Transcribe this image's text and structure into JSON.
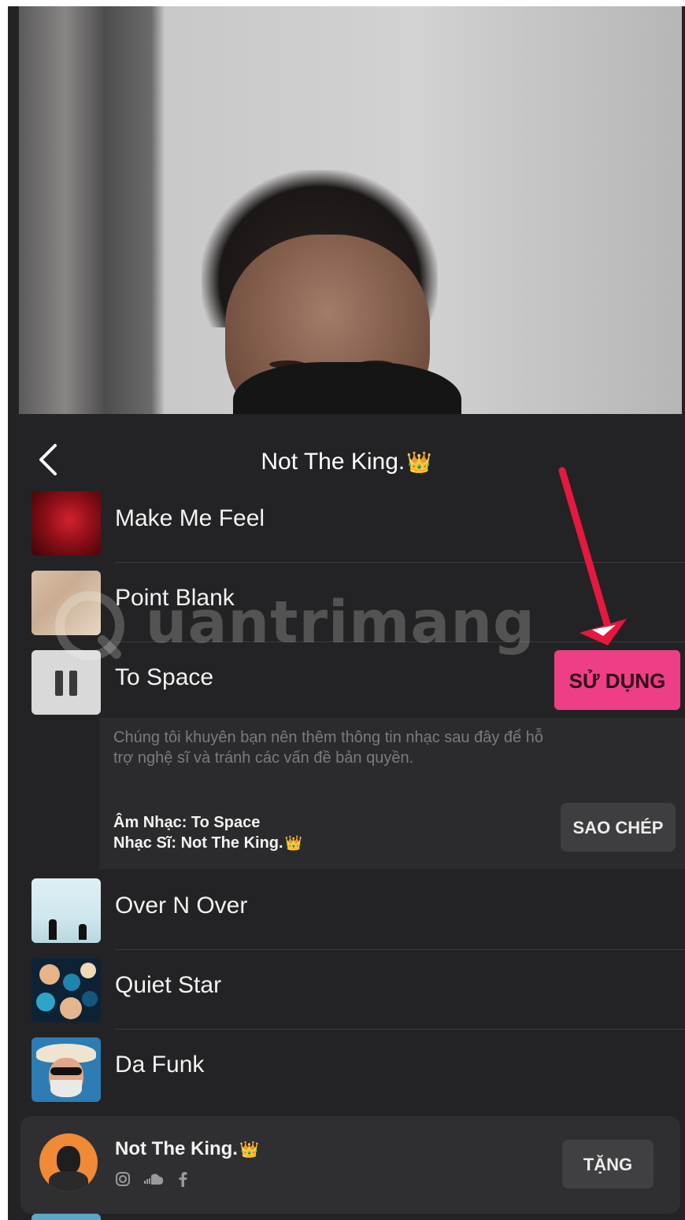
{
  "header": {
    "title": "Not The King.",
    "crown": "👑"
  },
  "songs": [
    {
      "title": "Make Me Feel",
      "art": "rose-art"
    },
    {
      "title": "Point Blank",
      "art": "point-blank-art"
    },
    {
      "title": "To Space",
      "art": "pause-icon",
      "playing": true
    },
    {
      "title": "Over N Over",
      "art": "over-n-over-art"
    },
    {
      "title": "Quiet Star",
      "art": "quiet-star-art"
    },
    {
      "title": "Da Funk",
      "art": "da-funk-art"
    }
  ],
  "use_button": "SỬ DỤNG",
  "info": {
    "notice": "Chúng tôi khuyên bạn nên thêm thông tin nhạc sau đây để hỗ trợ nghệ sĩ và tránh các vấn đề bản quyền.",
    "music_line": "Âm Nhạc: To Space",
    "artist_line": "Nhạc Sĩ: Not The King.",
    "copy_button": "SAO CHÉP"
  },
  "artist": {
    "name": "Not The King.",
    "gift_button": "TẶNG",
    "socials": [
      "instagram-icon",
      "soundcloud-icon",
      "facebook-icon"
    ]
  },
  "watermark": "uantrimang",
  "colors": {
    "accent": "#ee3f86",
    "annotation": "#e5183f",
    "background": "#232325"
  }
}
